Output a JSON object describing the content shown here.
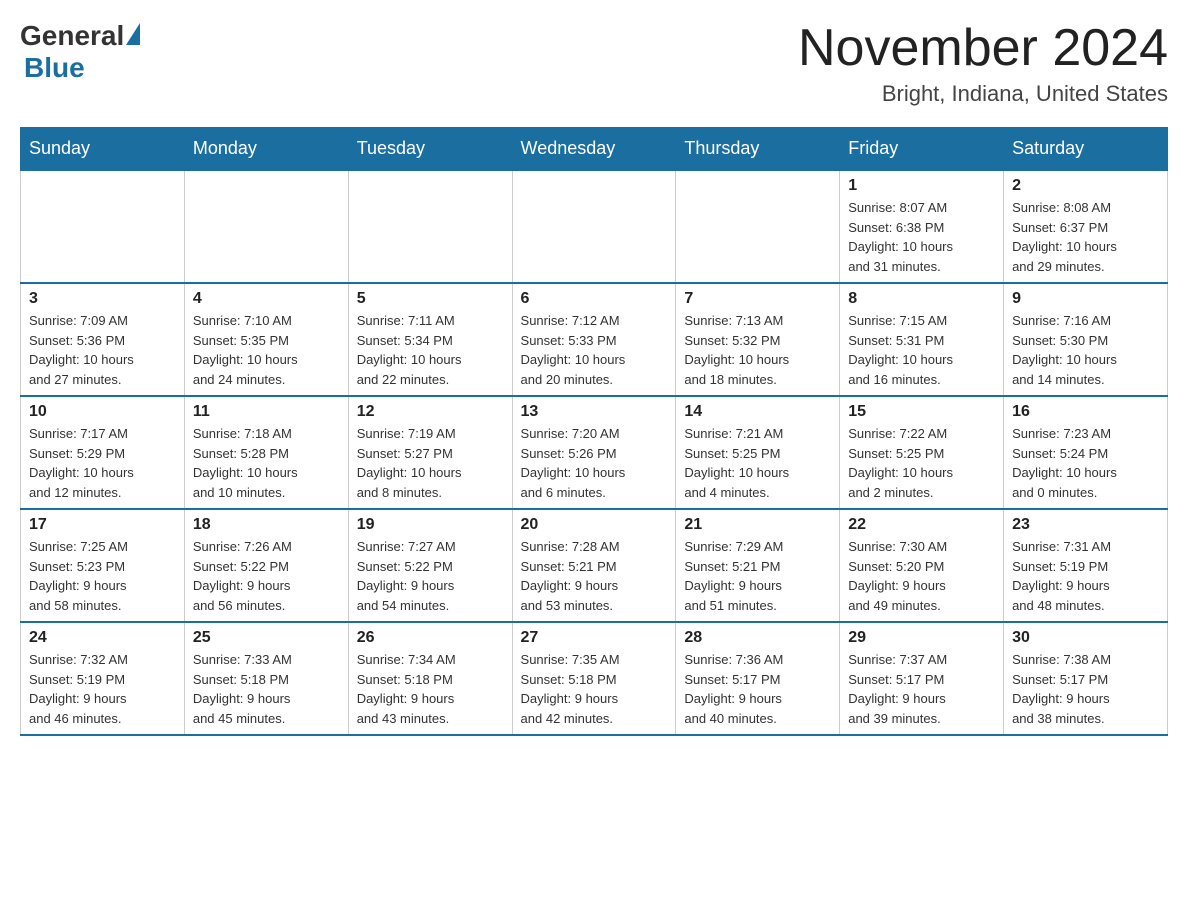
{
  "header": {
    "logo_general": "General",
    "logo_blue": "Blue",
    "month_title": "November 2024",
    "location": "Bright, Indiana, United States"
  },
  "days_of_week": [
    "Sunday",
    "Monday",
    "Tuesday",
    "Wednesday",
    "Thursday",
    "Friday",
    "Saturday"
  ],
  "weeks": [
    [
      {
        "day": "",
        "info": "",
        "empty": true
      },
      {
        "day": "",
        "info": "",
        "empty": true
      },
      {
        "day": "",
        "info": "",
        "empty": true
      },
      {
        "day": "",
        "info": "",
        "empty": true
      },
      {
        "day": "",
        "info": "",
        "empty": true
      },
      {
        "day": "1",
        "info": "Sunrise: 8:07 AM\nSunset: 6:38 PM\nDaylight: 10 hours\nand 31 minutes."
      },
      {
        "day": "2",
        "info": "Sunrise: 8:08 AM\nSunset: 6:37 PM\nDaylight: 10 hours\nand 29 minutes."
      }
    ],
    [
      {
        "day": "3",
        "info": "Sunrise: 7:09 AM\nSunset: 5:36 PM\nDaylight: 10 hours\nand 27 minutes."
      },
      {
        "day": "4",
        "info": "Sunrise: 7:10 AM\nSunset: 5:35 PM\nDaylight: 10 hours\nand 24 minutes."
      },
      {
        "day": "5",
        "info": "Sunrise: 7:11 AM\nSunset: 5:34 PM\nDaylight: 10 hours\nand 22 minutes."
      },
      {
        "day": "6",
        "info": "Sunrise: 7:12 AM\nSunset: 5:33 PM\nDaylight: 10 hours\nand 20 minutes."
      },
      {
        "day": "7",
        "info": "Sunrise: 7:13 AM\nSunset: 5:32 PM\nDaylight: 10 hours\nand 18 minutes."
      },
      {
        "day": "8",
        "info": "Sunrise: 7:15 AM\nSunset: 5:31 PM\nDaylight: 10 hours\nand 16 minutes."
      },
      {
        "day": "9",
        "info": "Sunrise: 7:16 AM\nSunset: 5:30 PM\nDaylight: 10 hours\nand 14 minutes."
      }
    ],
    [
      {
        "day": "10",
        "info": "Sunrise: 7:17 AM\nSunset: 5:29 PM\nDaylight: 10 hours\nand 12 minutes."
      },
      {
        "day": "11",
        "info": "Sunrise: 7:18 AM\nSunset: 5:28 PM\nDaylight: 10 hours\nand 10 minutes."
      },
      {
        "day": "12",
        "info": "Sunrise: 7:19 AM\nSunset: 5:27 PM\nDaylight: 10 hours\nand 8 minutes."
      },
      {
        "day": "13",
        "info": "Sunrise: 7:20 AM\nSunset: 5:26 PM\nDaylight: 10 hours\nand 6 minutes."
      },
      {
        "day": "14",
        "info": "Sunrise: 7:21 AM\nSunset: 5:25 PM\nDaylight: 10 hours\nand 4 minutes."
      },
      {
        "day": "15",
        "info": "Sunrise: 7:22 AM\nSunset: 5:25 PM\nDaylight: 10 hours\nand 2 minutes."
      },
      {
        "day": "16",
        "info": "Sunrise: 7:23 AM\nSunset: 5:24 PM\nDaylight: 10 hours\nand 0 minutes."
      }
    ],
    [
      {
        "day": "17",
        "info": "Sunrise: 7:25 AM\nSunset: 5:23 PM\nDaylight: 9 hours\nand 58 minutes."
      },
      {
        "day": "18",
        "info": "Sunrise: 7:26 AM\nSunset: 5:22 PM\nDaylight: 9 hours\nand 56 minutes."
      },
      {
        "day": "19",
        "info": "Sunrise: 7:27 AM\nSunset: 5:22 PM\nDaylight: 9 hours\nand 54 minutes."
      },
      {
        "day": "20",
        "info": "Sunrise: 7:28 AM\nSunset: 5:21 PM\nDaylight: 9 hours\nand 53 minutes."
      },
      {
        "day": "21",
        "info": "Sunrise: 7:29 AM\nSunset: 5:21 PM\nDaylight: 9 hours\nand 51 minutes."
      },
      {
        "day": "22",
        "info": "Sunrise: 7:30 AM\nSunset: 5:20 PM\nDaylight: 9 hours\nand 49 minutes."
      },
      {
        "day": "23",
        "info": "Sunrise: 7:31 AM\nSunset: 5:19 PM\nDaylight: 9 hours\nand 48 minutes."
      }
    ],
    [
      {
        "day": "24",
        "info": "Sunrise: 7:32 AM\nSunset: 5:19 PM\nDaylight: 9 hours\nand 46 minutes."
      },
      {
        "day": "25",
        "info": "Sunrise: 7:33 AM\nSunset: 5:18 PM\nDaylight: 9 hours\nand 45 minutes."
      },
      {
        "day": "26",
        "info": "Sunrise: 7:34 AM\nSunset: 5:18 PM\nDaylight: 9 hours\nand 43 minutes."
      },
      {
        "day": "27",
        "info": "Sunrise: 7:35 AM\nSunset: 5:18 PM\nDaylight: 9 hours\nand 42 minutes."
      },
      {
        "day": "28",
        "info": "Sunrise: 7:36 AM\nSunset: 5:17 PM\nDaylight: 9 hours\nand 40 minutes."
      },
      {
        "day": "29",
        "info": "Sunrise: 7:37 AM\nSunset: 5:17 PM\nDaylight: 9 hours\nand 39 minutes."
      },
      {
        "day": "30",
        "info": "Sunrise: 7:38 AM\nSunset: 5:17 PM\nDaylight: 9 hours\nand 38 minutes."
      }
    ]
  ]
}
